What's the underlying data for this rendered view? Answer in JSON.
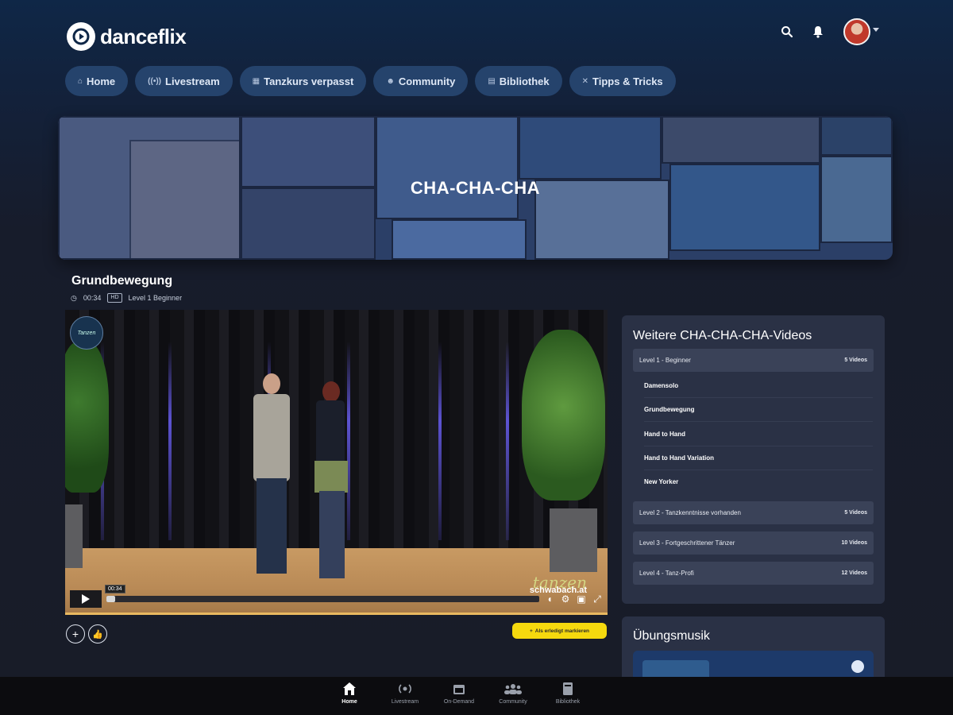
{
  "brand": {
    "name": "danceflix"
  },
  "header": {
    "search_icon": "search-icon",
    "bell_icon": "bell-icon"
  },
  "nav": [
    {
      "icon": "home-icon",
      "glyph": "⌂",
      "label": "Home"
    },
    {
      "icon": "livestream-icon",
      "glyph": "((•))",
      "label": "Livestream"
    },
    {
      "icon": "calendar-icon",
      "glyph": "▦",
      "label": "Tanzkurs verpasst"
    },
    {
      "icon": "community-icon",
      "glyph": "☻",
      "label": "Community"
    },
    {
      "icon": "library-icon",
      "glyph": "▤",
      "label": "Bibliothek"
    },
    {
      "icon": "tips-icon",
      "glyph": "✕",
      "label": "Tipps & Tricks"
    }
  ],
  "banner": {
    "title": "CHA-CHA-CHA"
  },
  "video": {
    "title": "Grundbewegung",
    "duration": "00:34",
    "quality_badge": "HD",
    "level": "Level 1 Beginner",
    "current_time": "00:34",
    "progress_fraction": 0.02,
    "watermark": "tanzen",
    "watermark_sub": "schwabach.at",
    "mark_done_label": "Als erledigt markieren"
  },
  "sidebar": {
    "title": "Weitere CHA-CHA-CHA-Videos",
    "levels": [
      {
        "label": "Level 1 - Beginner",
        "count": "5 Videos",
        "items": [
          "Damensolo",
          "Grundbewegung",
          "Hand to Hand",
          "Hand to Hand Variation",
          "New Yorker"
        ]
      },
      {
        "label": "Level 2 - Tanzkenntnisse vorhanden",
        "count": "5 Videos"
      },
      {
        "label": "Level 3 - Fortgeschrittener Tänzer",
        "count": "10 Videos"
      },
      {
        "label": "Level 4 - Tanz-Profi",
        "count": "12 Videos"
      }
    ]
  },
  "music": {
    "title": "Übungsmusik"
  },
  "bottom_nav": [
    {
      "icon": "home-icon",
      "label": "Home",
      "active": true
    },
    {
      "icon": "livestream-icon",
      "label": "Livestream"
    },
    {
      "icon": "calendar-icon",
      "label": "On-Demand"
    },
    {
      "icon": "community-icon",
      "label": "Community"
    },
    {
      "icon": "library-icon",
      "label": "Bibliothek"
    }
  ],
  "colors": {
    "accent": "#f5d90e",
    "pill": "#25436c",
    "panel": "#2a3145"
  }
}
